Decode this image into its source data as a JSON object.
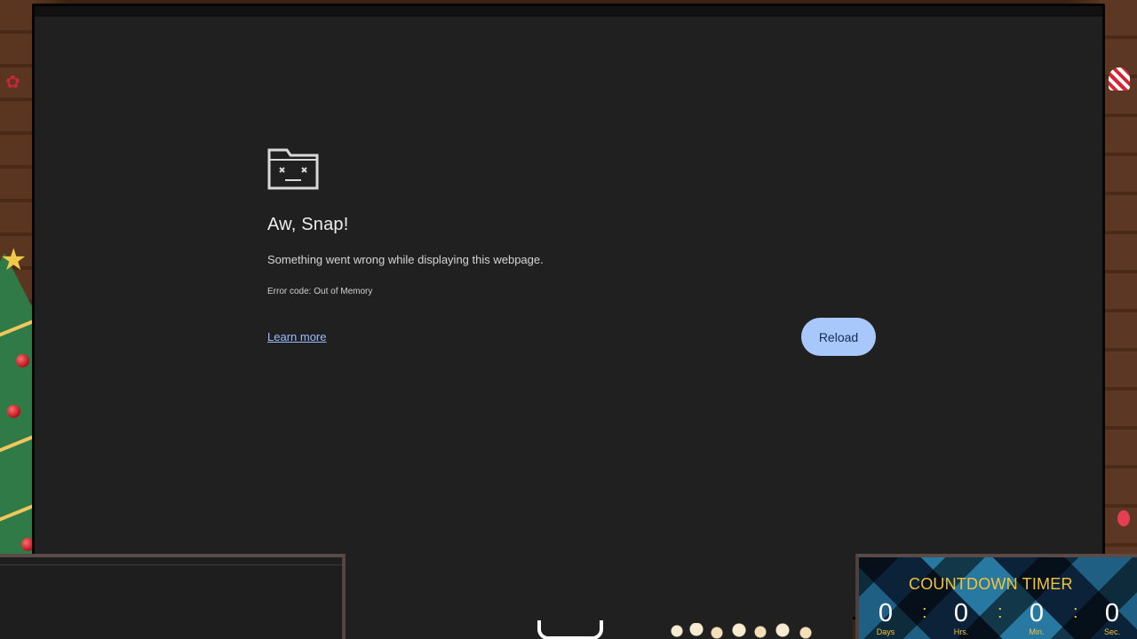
{
  "browser": {
    "error": {
      "icon": "sad-tab-icon",
      "title": "Aw, Snap!",
      "message": "Something went wrong while displaying this webpage.",
      "code": "Error code: Out of Memory",
      "learn_more": "Learn more",
      "reload": "Reload"
    }
  },
  "countdown": {
    "title": "COUNTDOWN TIMER",
    "days": "0",
    "days_label": "Days",
    "hours": "0",
    "hours_label": "Hrs.",
    "minutes": "0",
    "minutes_label": "Min.",
    "seconds": "0",
    "seconds_label": "Sec.",
    "separator": ":"
  },
  "colors": {
    "page_background": "#202020",
    "reload_button": "#a8c7fa",
    "link": "#9bbcff",
    "countdown_accent": "#f5c338"
  }
}
